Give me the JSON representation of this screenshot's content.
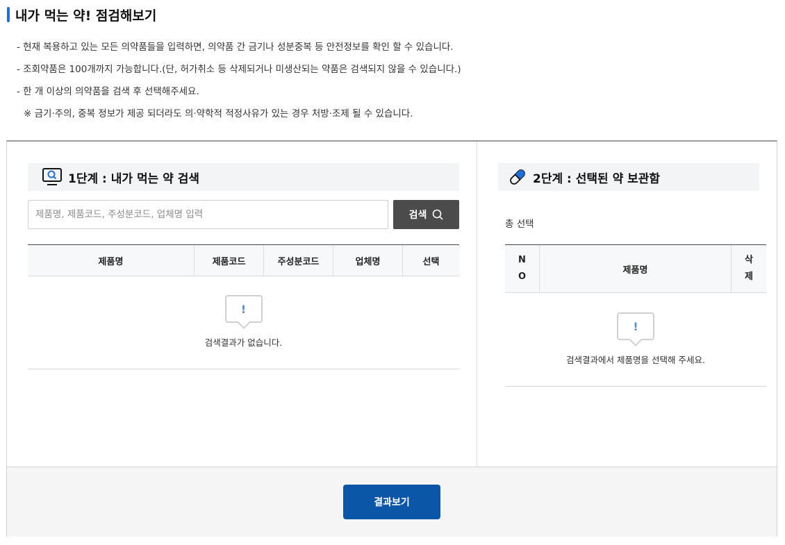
{
  "page": {
    "title": "내가 먹는 약! 점검해보기"
  },
  "notes": [
    "- 현재 복용하고 있는 모든 의약품들을 입력하면, 의약품 간 금기나 성분중복 등 안전정보를 확인 할 수 있습니다.",
    "- 조회약품은 100개까지 가능합니다.(단, 허가취소 등 삭제되거나 미생산되는 약품은 검색되지 않을 수 있습니다.)",
    "- 한 개 이상의 의약품을 검색 후 선택해주세요.",
    "※ 금기·주의, 중복 정보가 제공 되더라도 의·약학적 적정사유가 있는 경우 처방·조제 될 수 있습니다."
  ],
  "step1": {
    "title": "1단계 : 내가 먹는 약 검색",
    "icon": "monitor-search-icon",
    "search_placeholder": "제품명, 제품코드, 주성분코드, 업체명 입력",
    "search_button": "검색",
    "columns": [
      "제품명",
      "제품코드",
      "주성분코드",
      "업체명",
      "선택"
    ],
    "empty_mark": "!",
    "empty_message": "검색결과가 없습니다."
  },
  "step2": {
    "title": "2단계 : 선택된 약 보관함",
    "icon": "pill-icon",
    "total_label": "총 선택",
    "columns": {
      "no_line1": "N",
      "no_line2": "O",
      "name": "제품명",
      "delete_line1": "삭",
      "delete_line2": "제"
    },
    "empty_mark": "!",
    "empty_message": "검색결과에서 제품명을 선택해 주세요."
  },
  "footer": {
    "result_button": "결과보기"
  },
  "colors": {
    "accent": "#1e6fd9",
    "primary_button": "#0c56a8",
    "search_button": "#4b4b4b"
  }
}
